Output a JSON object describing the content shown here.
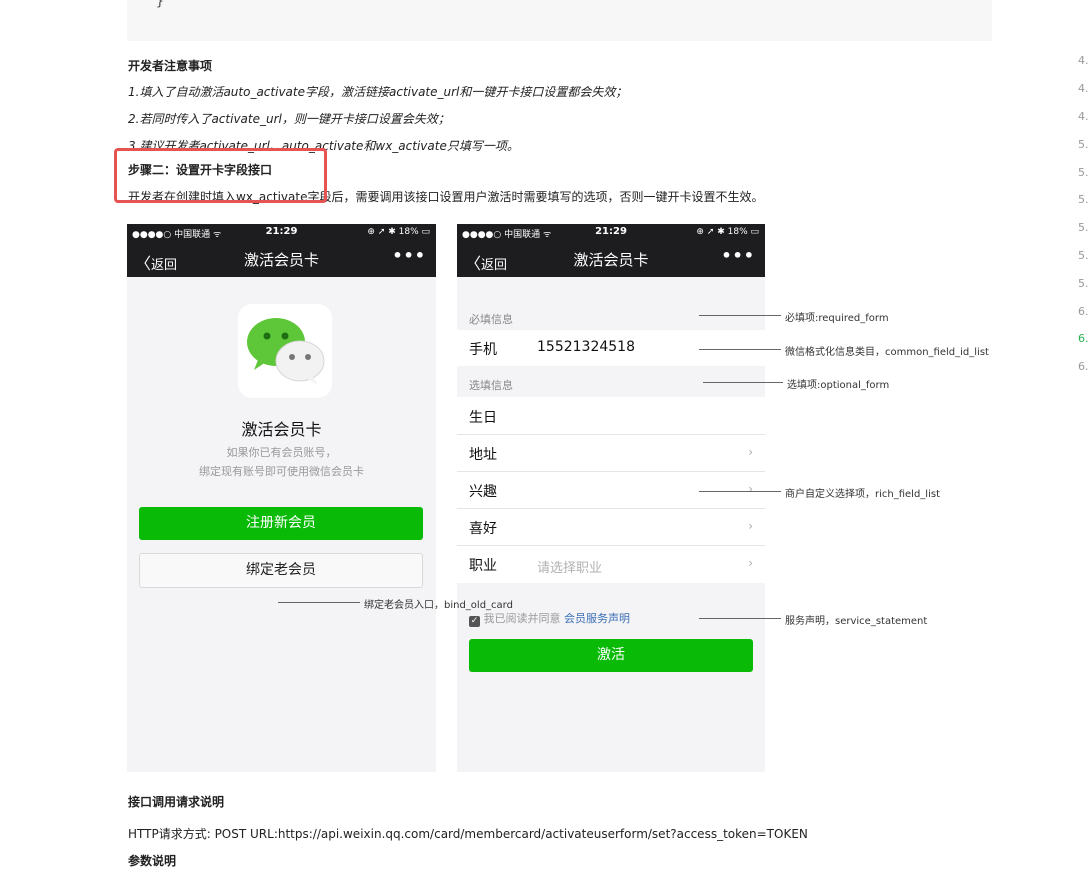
{
  "code_block": {
    "closing_brace": "}"
  },
  "notes": {
    "heading": "开发者注意事项",
    "items": [
      "1.填入了自动激活auto_activate字段，激活链接activate_url和一键开卡接口设置都会失效；",
      "2.若同时传入了activate_url，则一键开卡接口设置会失效；",
      "3.建议开发者activate_url、auto_activate和wx_activate只填写一项。"
    ]
  },
  "step2": {
    "heading": "步骤二：设置开卡字段接口",
    "desc": "开发者在创建时填入wx_activate字段后，需要调用该接口设置用户激活时需要填写的选项，否则一键开卡设置不生效。"
  },
  "status_bar": {
    "carrier": "●●●●○ 中国联通 ᯤ",
    "time": "21:29",
    "right": "⊕ ➚ ✱ 18% ▭"
  },
  "phone1": {
    "back": "返回",
    "title": "激活会员卡",
    "more": "•••",
    "card_title": "激活会员卡",
    "desc_line1": "如果你已有会员账号，",
    "desc_line2": "绑定现有账号即可使用微信会员卡",
    "register_btn": "注册新会员",
    "bind_btn": "绑定老会员"
  },
  "phone2": {
    "back": "返回",
    "title": "激活会员卡",
    "more": "•••",
    "required_section": "必填信息",
    "phone_label": "手机",
    "phone_value": "15521324518",
    "optional_section": "选填信息",
    "fields": [
      {
        "label": "生日",
        "value": "",
        "chevron": false
      },
      {
        "label": "地址",
        "value": "",
        "chevron": true
      },
      {
        "label": "兴趣",
        "value": "",
        "chevron": true
      },
      {
        "label": "喜好",
        "value": "",
        "chevron": true
      },
      {
        "label": "职业",
        "value": "请选择职业",
        "chevron": true
      }
    ],
    "agree_text": "我已阅读并同意",
    "agree_link": "会员服务声明",
    "activate_btn": "激活"
  },
  "annotations": {
    "required_form": "必填项:required_form",
    "common_field": "微信格式化信息类目，common_field_id_list",
    "optional_form": "选填项:optional_form",
    "rich_field": "商户自定义选择项，rich_field_list",
    "bind_old_card": "绑定老会员入口，bind_old_card",
    "service_statement": "服务声明，service_statement"
  },
  "api": {
    "heading": "接口调用请求说明",
    "http_line": "HTTP请求方式: POST URL:https://api.weixin.qq.com/card/membercard/activateuserform/set?access_token=TOKEN",
    "params_heading": "参数说明"
  },
  "line_numbers": [
    "4.",
    "4.",
    "4.",
    "5.",
    "5.",
    "5.",
    "5.",
    "5.",
    "5.",
    "6.",
    "6.",
    "6."
  ],
  "colors": {
    "highlight_border": "#e55353",
    "wechat_green": "#09bb07",
    "link_blue": "#3b6fb6"
  }
}
